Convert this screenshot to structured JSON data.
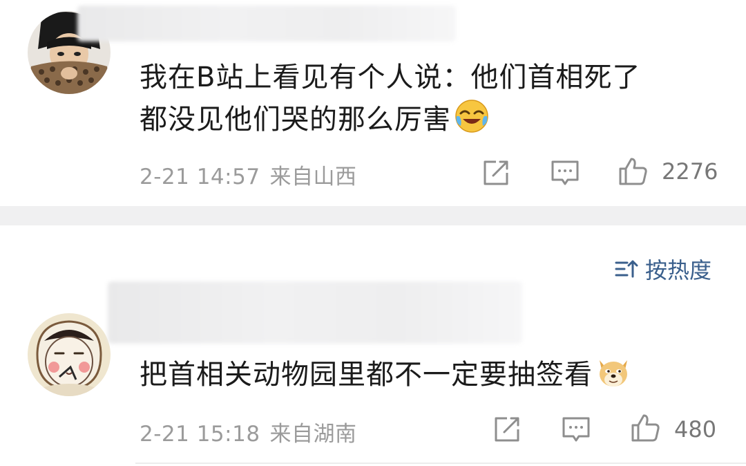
{
  "comments": [
    {
      "text_line1": "我在B站上看见有个人说：他们首相死了",
      "text_line2": "都没见他们哭的那么厉害",
      "emoji": "laugh-cry-emoji",
      "time": "2-21 14:57",
      "location": "来自山西",
      "likes": "2276"
    },
    {
      "text_line1": "把首相关动物园里都不一定要抽签看",
      "emoji": "doge-emoji",
      "time": "2-21 15:18",
      "location": "来自湖南",
      "likes": "480"
    }
  ],
  "sort": {
    "label": "按热度",
    "icon": "sort-icon"
  },
  "icons": {
    "share": "share-icon",
    "reply": "comment-icon",
    "like": "thumbs-up-icon"
  },
  "colors": {
    "link_blue": "#3a5f8c",
    "meta_gray": "#9b9b9b",
    "divider": "#f0f0f1"
  }
}
